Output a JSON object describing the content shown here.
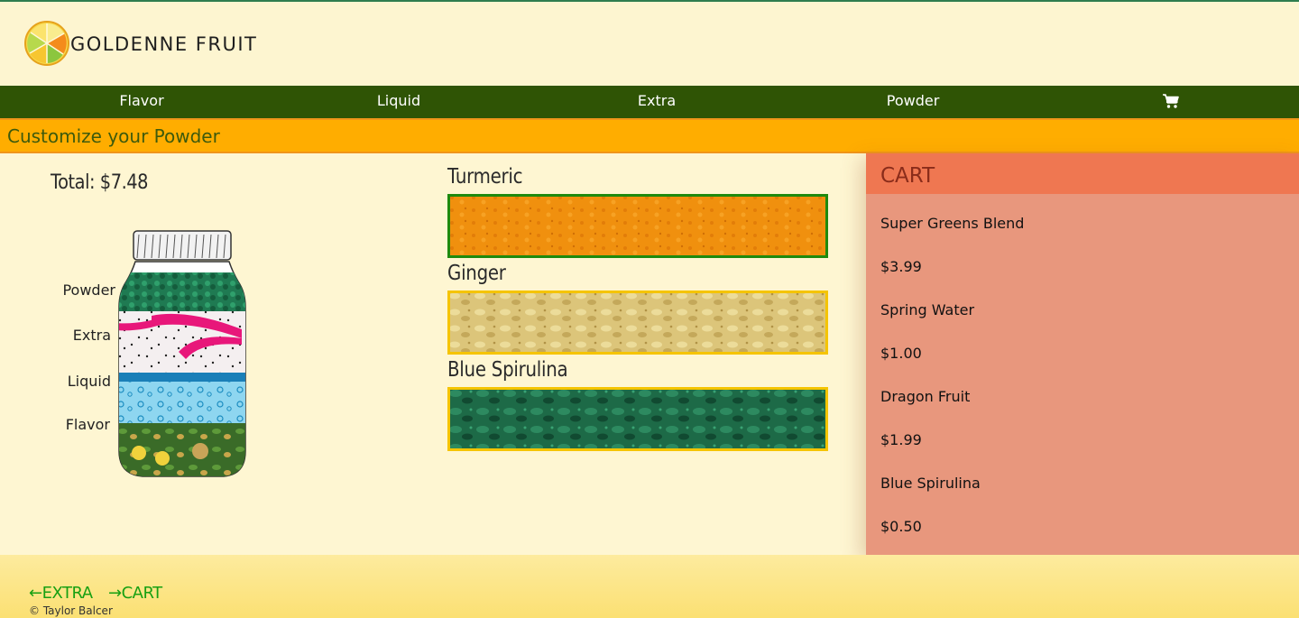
{
  "brand": {
    "name": "GOLDENNE FRUIT",
    "logo": "citrus-slice-logo"
  },
  "nav": {
    "items": [
      {
        "label": "Flavor"
      },
      {
        "label": "Liquid"
      },
      {
        "label": "Extra"
      },
      {
        "label": "Powder"
      }
    ],
    "cart_icon": "shopping-cart-icon"
  },
  "banner": {
    "title": "Customize your Powder"
  },
  "summary": {
    "total": "Total: $7.48"
  },
  "jar": {
    "layers": [
      "Powder",
      "Extra",
      "Liquid",
      "Flavor"
    ]
  },
  "options": [
    {
      "name": "Turmeric",
      "selected": true,
      "color": "#f08f0c"
    },
    {
      "name": "Ginger",
      "selected": false,
      "color": "#d9c070"
    },
    {
      "name": "Blue Spirulina",
      "selected": false,
      "color": "#1f6e4a"
    }
  ],
  "cart": {
    "title": "CART",
    "items": [
      {
        "name": "Super Greens Blend",
        "price": "$3.99"
      },
      {
        "name": "Spring Water",
        "price": "$1.00"
      },
      {
        "name": "Dragon Fruit",
        "price": "$1.99"
      },
      {
        "name": "Blue Spirulina",
        "price": "$0.50"
      }
    ]
  },
  "footer": {
    "back_link": "←EXTRA",
    "next_link": "→CART",
    "copyright": "© Taylor Balcer"
  },
  "colors": {
    "nav_bg": "#2f5405",
    "banner_bg": "#ffad00",
    "cart_bg": "#e8977d",
    "cart_header": "#ef7751",
    "selected_border": "#1e8a0e",
    "unselected_border": "#f5c400",
    "link_green": "#17a012"
  }
}
